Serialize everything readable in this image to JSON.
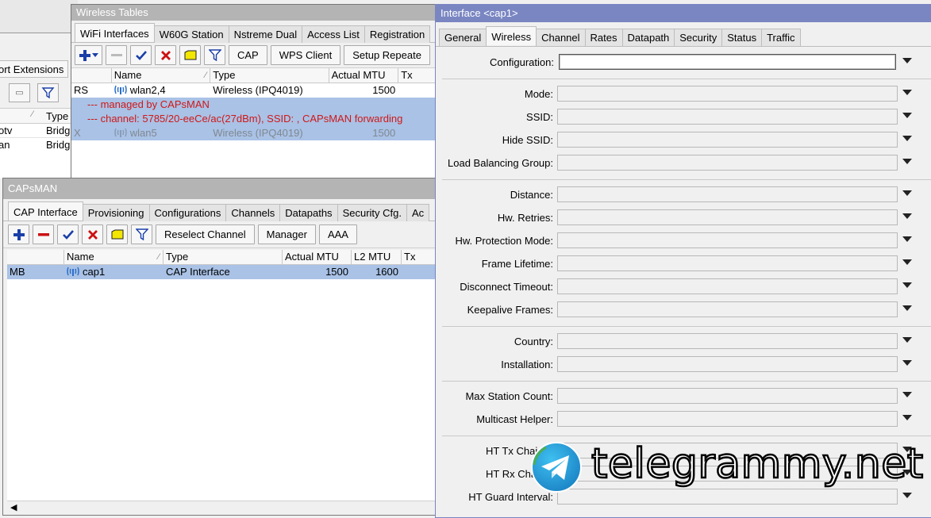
{
  "bg_window": {
    "tab_label": "ort Extensions",
    "header_type": "Type",
    "rows": [
      {
        "name": "otv",
        "type": "Bridg"
      },
      {
        "name": "an",
        "type": "Bridg"
      }
    ]
  },
  "wireless_tables": {
    "title": "Wireless Tables",
    "tabs": [
      "WiFi Interfaces",
      "W60G Station",
      "Nstreme Dual",
      "Access List",
      "Registration"
    ],
    "toolbar": {
      "cap": "CAP",
      "wps_client": "WPS Client",
      "setup_repeater": "Setup Repeate"
    },
    "columns": [
      "",
      "Name",
      "Type",
      "Actual MTU",
      "Tx"
    ],
    "rows": [
      {
        "flags": "RS",
        "name": "wlan2,4",
        "type": "Wireless (IPQ4019)",
        "mtu": "1500"
      },
      {
        "flags": "X",
        "name": "wlan5",
        "type": "Wireless (IPQ4019)",
        "mtu": "1500"
      }
    ],
    "comments": [
      "--- managed by CAPsMAN",
      "--- channel: 5785/20-eeCe/ac(27dBm), SSID: , CAPsMAN forwarding"
    ]
  },
  "capsman": {
    "title": "CAPsMAN",
    "tabs": [
      "CAP Interface",
      "Provisioning",
      "Configurations",
      "Channels",
      "Datapaths",
      "Security Cfg.",
      "Ac"
    ],
    "toolbar": {
      "reselect": "Reselect Channel",
      "manager": "Manager",
      "aaa": "AAA"
    },
    "columns": [
      "",
      "Name",
      "Type",
      "Actual MTU",
      "L2 MTU",
      "Tx"
    ],
    "rows": [
      {
        "flags": "MB",
        "name": "cap1",
        "type": "CAP Interface",
        "mtu": "1500",
        "l2mtu": "1600"
      }
    ]
  },
  "interface": {
    "title": "Interface <cap1>",
    "tabs": [
      "General",
      "Wireless",
      "Channel",
      "Rates",
      "Datapath",
      "Security",
      "Status",
      "Traffic"
    ],
    "fields": {
      "configuration": "Configuration:",
      "mode": "Mode:",
      "ssid": "SSID:",
      "hide_ssid": "Hide SSID:",
      "load_balancing": "Load Balancing Group:",
      "distance": "Distance:",
      "hw_retries": "Hw. Retries:",
      "hw_protection": "Hw. Protection Mode:",
      "frame_lifetime": "Frame Lifetime:",
      "disconnect_timeout": "Disconnect Timeout:",
      "keepalive": "Keepalive Frames:",
      "country": "Country:",
      "installation": "Installation:",
      "max_station": "Max Station Count:",
      "multicast_helper": "Multicast Helper:",
      "ht_tx": "HT Tx Chai",
      "ht_rx": "HT Rx Cha",
      "ht_guard": "HT Guard Interval:"
    }
  },
  "watermark": {
    "text": "telegrammy.net"
  },
  "colors": {
    "active_title": "#7a86c2",
    "inactive_title": "#b4b4b4",
    "selection": "#a9c2e6",
    "comment_red": "#d01818",
    "add_blue": "#1a3fa8",
    "remove_red": "#cc1111",
    "telegram_blue": "#2aa3dc"
  }
}
